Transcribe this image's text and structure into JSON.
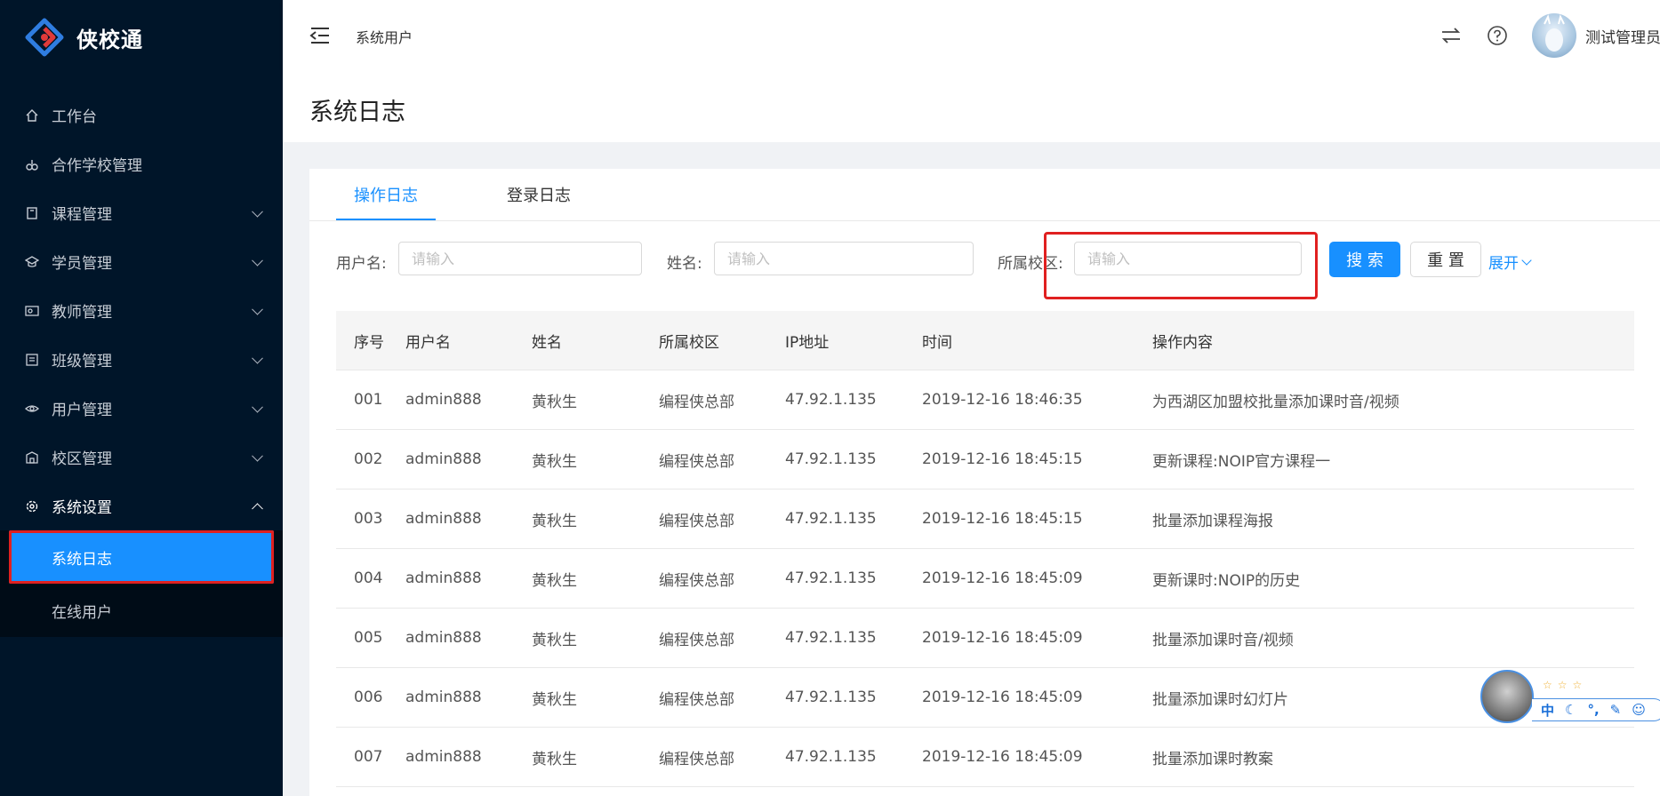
{
  "app": {
    "name": "侠校通"
  },
  "sidebar": {
    "items": [
      {
        "label": "工作台",
        "icon": "home-icon",
        "chevron": false
      },
      {
        "label": "合作学校管理",
        "icon": "partner-icon",
        "chevron": false
      },
      {
        "label": "课程管理",
        "icon": "book-icon",
        "chevron": true
      },
      {
        "label": "学员管理",
        "icon": "student-icon",
        "chevron": true
      },
      {
        "label": "教师管理",
        "icon": "teacher-icon",
        "chevron": true
      },
      {
        "label": "班级管理",
        "icon": "class-icon",
        "chevron": true
      },
      {
        "label": "用户管理",
        "icon": "users-icon",
        "chevron": true
      },
      {
        "label": "校区管理",
        "icon": "campus-icon",
        "chevron": true
      },
      {
        "label": "系统设置",
        "icon": "settings-icon",
        "chevron": true
      }
    ],
    "submenu": [
      {
        "label": "系统日志",
        "active": true
      },
      {
        "label": "在线用户",
        "active": false
      }
    ]
  },
  "header": {
    "breadcrumb": "系统用户",
    "username": "测试管理员"
  },
  "page": {
    "title": "系统日志"
  },
  "tabs": [
    {
      "label": "操作日志",
      "active": true
    },
    {
      "label": "登录日志",
      "active": false
    }
  ],
  "filters": {
    "username_label": "用户名:",
    "name_label": "姓名:",
    "campus_label": "所属校区:",
    "placeholder": "请输入",
    "search_label": "搜 索",
    "reset_label": "重 置",
    "expand_label": "展开"
  },
  "table": {
    "columns": [
      "序号",
      "用户名",
      "姓名",
      "所属校区",
      "IP地址",
      "时间",
      "操作内容"
    ],
    "rows": [
      [
        "001",
        "admin888",
        "黄秋生",
        "编程侠总部",
        "47.92.1.135",
        "2019-12-16 18:46:35",
        "为西湖区加盟校批量添加课时音/视频"
      ],
      [
        "002",
        "admin888",
        "黄秋生",
        "编程侠总部",
        "47.92.1.135",
        "2019-12-16 18:45:15",
        "更新课程:NOIP官方课程一"
      ],
      [
        "003",
        "admin888",
        "黄秋生",
        "编程侠总部",
        "47.92.1.135",
        "2019-12-16 18:45:15",
        "批量添加课程海报"
      ],
      [
        "004",
        "admin888",
        "黄秋生",
        "编程侠总部",
        "47.92.1.135",
        "2019-12-16 18:45:09",
        "更新课时:NOIP的历史"
      ],
      [
        "005",
        "admin888",
        "黄秋生",
        "编程侠总部",
        "47.92.1.135",
        "2019-12-16 18:45:09",
        "批量添加课时音/视频"
      ],
      [
        "006",
        "admin888",
        "黄秋生",
        "编程侠总部",
        "47.92.1.135",
        "2019-12-16 18:45:09",
        "批量添加课时幻灯片"
      ],
      [
        "007",
        "admin888",
        "黄秋生",
        "编程侠总部",
        "47.92.1.135",
        "2019-12-16 18:45:09",
        "批量添加课时教案"
      ]
    ]
  },
  "ime_widget": {
    "stars": "☆☆☆",
    "lang": "中"
  },
  "colors": {
    "sidebar_bg": "#001529",
    "primary": "#1890ff",
    "highlight_border": "#e02020"
  }
}
